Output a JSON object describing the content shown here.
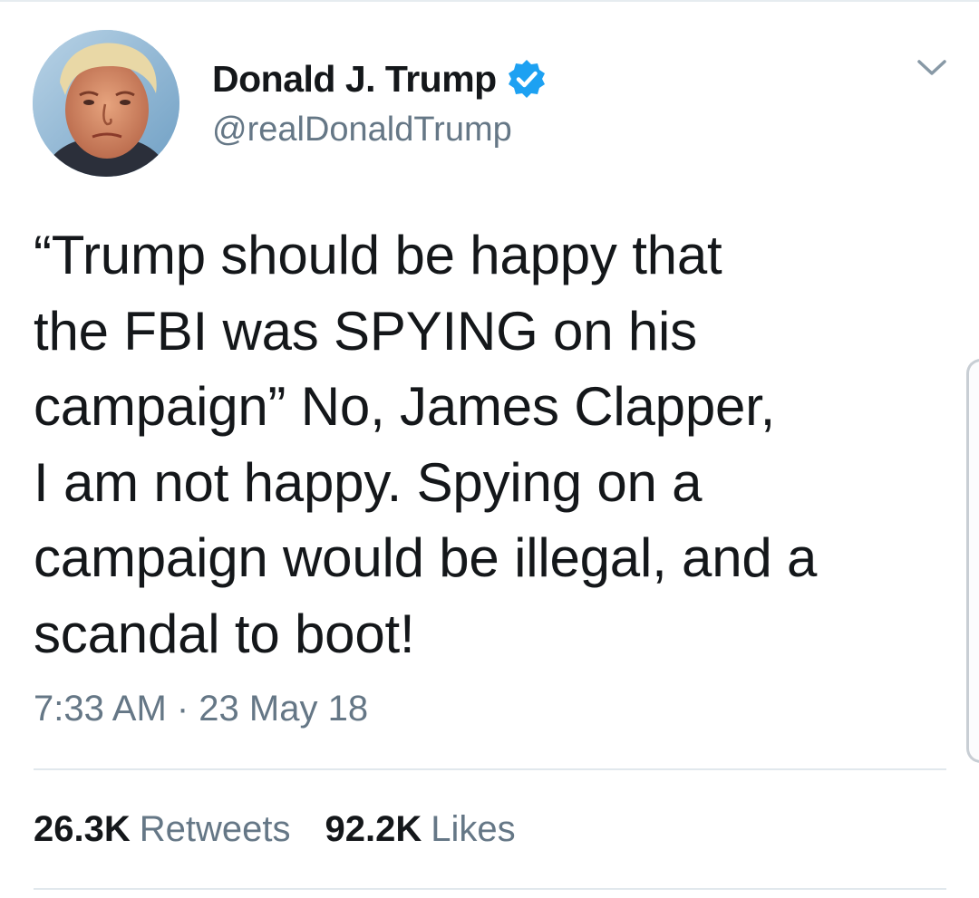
{
  "tweet": {
    "author": {
      "display_name": "Donald J. Trump",
      "handle": "@realDonaldTrump",
      "verified": true,
      "avatar_icon": "profile-photo"
    },
    "text": "“Trump should be happy that\nthe FBI was SPYING on his\ncampaign” No, James Clapper,\nI am not happy. Spying on a\ncampaign would be illegal, and a\nscandal to boot!",
    "timestamp": "7:33 AM · 23 May 18",
    "stats": {
      "retweets_count": "26.3K",
      "retweets_label": "Retweets",
      "likes_count": "92.2K",
      "likes_label": "Likes"
    }
  },
  "icons": {
    "verified": "verified-badge-icon",
    "menu": "chevron-down-icon"
  },
  "colors": {
    "text_primary": "#14171a",
    "text_secondary": "#657786",
    "verified_blue": "#1da1f2",
    "divider": "#e1e8ed"
  }
}
